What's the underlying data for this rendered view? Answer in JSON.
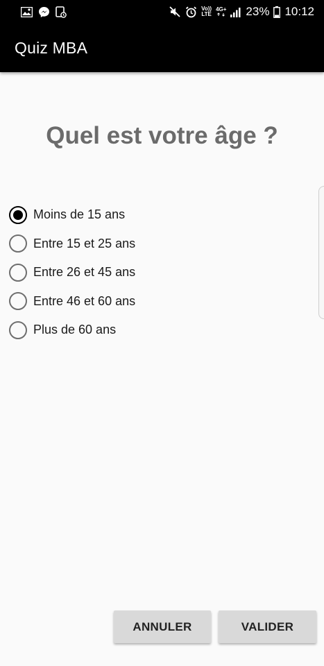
{
  "status_bar": {
    "icons_left": [
      "image-icon",
      "messenger-icon",
      "screenshot-icon"
    ],
    "icons_right": [
      "mute-icon",
      "alarm-icon",
      "volte-icon",
      "4g-icon",
      "signal-icon",
      "battery-icon"
    ],
    "volte_line1": "Vo))",
    "volte_line2": "LTE",
    "network": "4G+",
    "battery": "23%",
    "time": "10:12"
  },
  "app_bar": {
    "title": "Quiz MBA"
  },
  "question": {
    "text": "Quel est votre âge ?"
  },
  "options": [
    {
      "label": "Moins de 15 ans",
      "checked": true
    },
    {
      "label": "Entre 15 et 25 ans",
      "checked": false
    },
    {
      "label": "Entre 26 et 45 ans",
      "checked": false
    },
    {
      "label": "Entre 46 et 60 ans",
      "checked": false
    },
    {
      "label": "Plus de 60 ans",
      "checked": false
    }
  ],
  "buttons": {
    "cancel": "ANNULER",
    "validate": "VALIDER"
  },
  "colors": {
    "app_bar": "#000000",
    "background": "#fafafa",
    "question": "#6b6b6b",
    "button": "#d9d9d9"
  }
}
